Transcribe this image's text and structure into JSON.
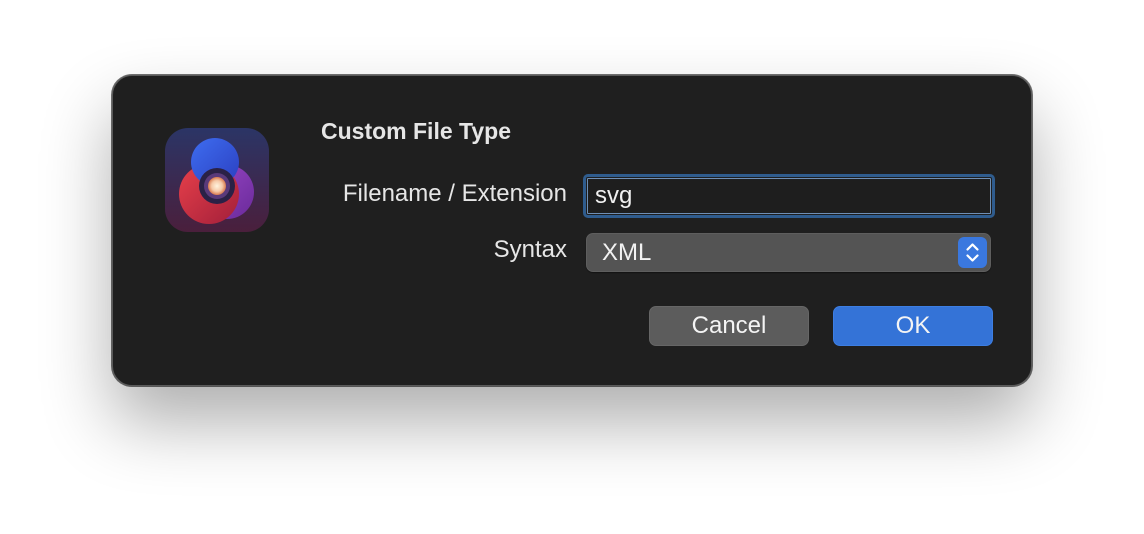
{
  "dialog": {
    "title": "Custom File Type",
    "app_icon": "app-logo-icon",
    "fields": {
      "filename_label": "Filename / Extension",
      "filename_value": "svg",
      "syntax_label": "Syntax",
      "syntax_value": "XML",
      "syntax_stepper_icon": "up-down-chevron-icon"
    },
    "buttons": {
      "cancel_label": "Cancel",
      "ok_label": "OK"
    }
  },
  "colors": {
    "dialog_background": "#1f1f1f",
    "accent": "#3473d7",
    "focus_ring": "#2f5c8e",
    "secondary_button": "#5c5c5c",
    "text": "#e6e6e6"
  }
}
